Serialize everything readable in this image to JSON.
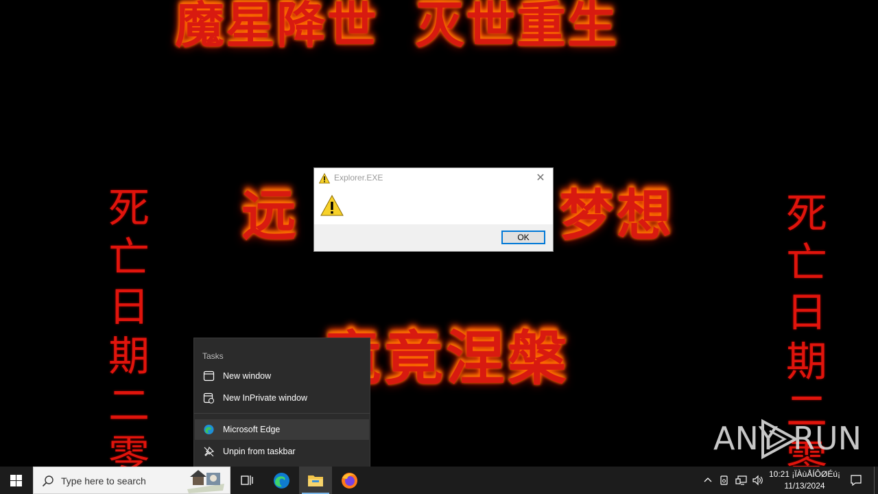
{
  "wallpaper": {
    "top_text": "魔星降世  灭世重生",
    "mid_left": "远",
    "mid_right": "梦想",
    "bottom_text": "竟竟涅槃",
    "left_vertical": [
      "死",
      "亡",
      "日",
      "期",
      "二",
      "零"
    ],
    "right_vertical": [
      "死",
      "亡",
      "日",
      "期",
      "二",
      "零"
    ]
  },
  "dialog": {
    "title": "Explorer.EXE",
    "ok_label": "OK",
    "icon": "warning-icon"
  },
  "jump_list": {
    "header": "Tasks",
    "items": [
      {
        "label": "New window",
        "icon": "window-icon"
      },
      {
        "label": "New InPrivate window",
        "icon": "inprivate-icon"
      },
      {
        "label": "Microsoft Edge",
        "icon": "edge-icon"
      },
      {
        "label": "Unpin from taskbar",
        "icon": "unpin-icon"
      }
    ]
  },
  "taskbar": {
    "search_placeholder": "Type here to search",
    "pinned": [
      "task-view-icon",
      "edge-icon",
      "file-explorer-icon",
      "firefox-icon"
    ]
  },
  "tray": {
    "time": "10:21 ¡ÏÀùÅÍÔØÉú¡",
    "date": "11/13/2024"
  },
  "watermark": {
    "text_left": "ANY",
    "text_right": "RUN"
  },
  "colors": {
    "accent": "#0078d7",
    "taskbar": "#1c1c1c",
    "jump_bg": "#2b2b2b",
    "fire_red": "#d81a10"
  }
}
